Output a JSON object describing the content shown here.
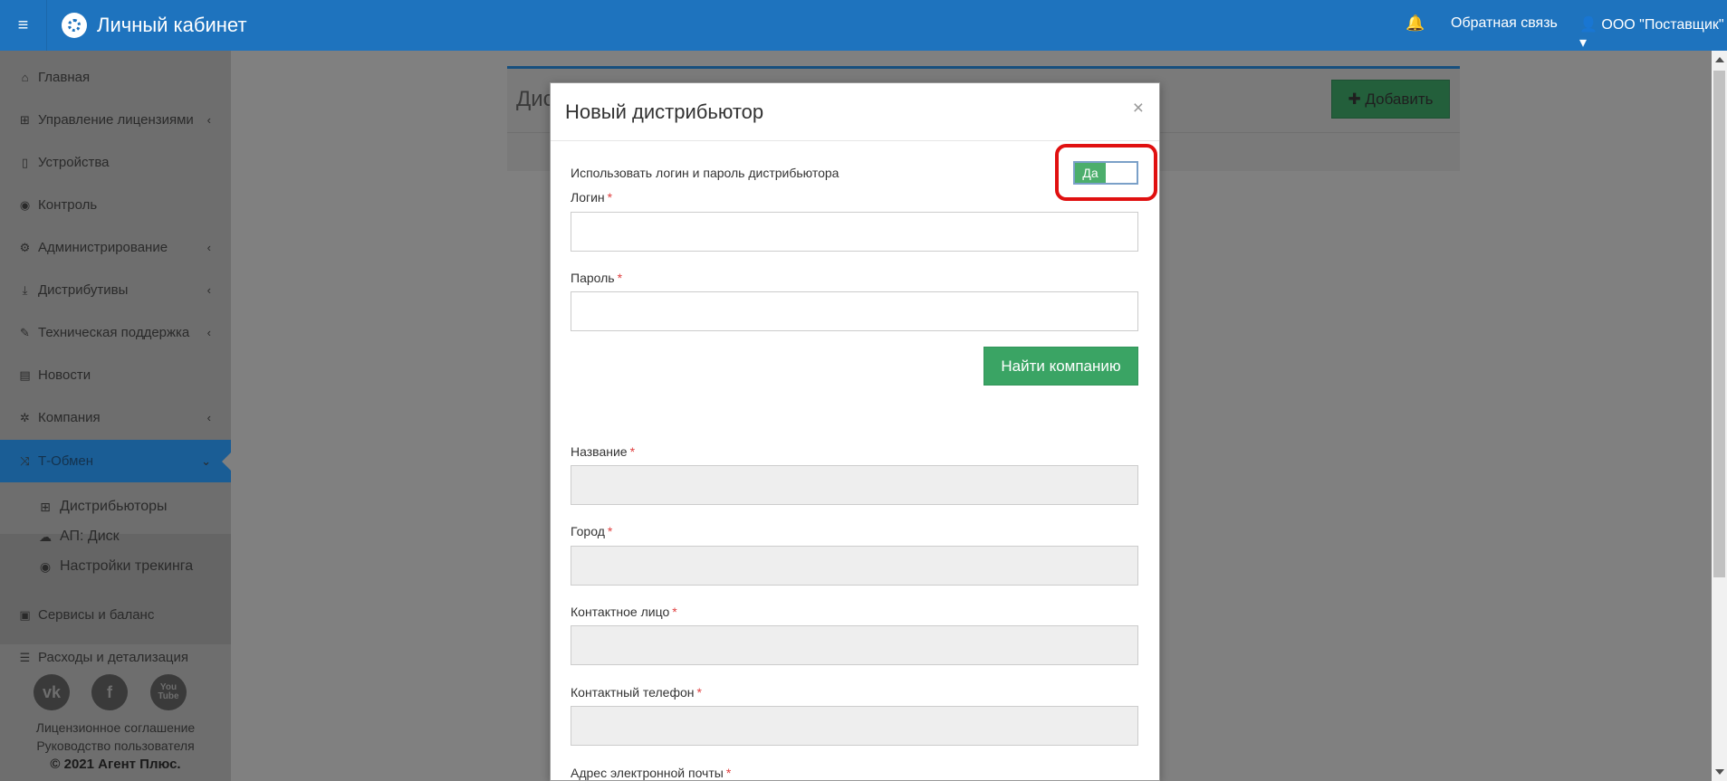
{
  "header": {
    "title": "Личный кабинет",
    "feedback": "Обратная связь",
    "user": "ООО \"Поставщик\" ▾",
    "menu_icon": "≡",
    "bell_icon": "🔔",
    "user_icon": "👤"
  },
  "sidebar": {
    "items": [
      {
        "label": "Главная",
        "icon": "⌂"
      },
      {
        "label": "Управление лицензиями",
        "icon": "⊞",
        "chevron": "‹"
      },
      {
        "label": "Устройства",
        "icon": "▯"
      },
      {
        "label": "Контроль",
        "icon": "◉"
      },
      {
        "label": "Администрирование",
        "icon": "⚙",
        "chevron": "‹"
      },
      {
        "label": "Дистрибутивы",
        "icon": "⤓",
        "chevron": "‹"
      },
      {
        "label": "Техническая поддержка",
        "icon": "✎",
        "chevron": "‹"
      },
      {
        "label": "Новости",
        "icon": "▤"
      },
      {
        "label": "Компания",
        "icon": "✲",
        "chevron": "‹"
      },
      {
        "label": "Т-Обмен",
        "icon": "⤨",
        "chevron": "⌄"
      },
      {
        "label": "Сервисы и баланс",
        "icon": "▣"
      },
      {
        "label": "Расходы и детализация",
        "icon": "☰"
      }
    ],
    "submenu": [
      {
        "label": "Дистрибьюторы",
        "icon": "⊞"
      },
      {
        "label": "АП: Диск",
        "icon": "☁"
      },
      {
        "label": "Настройки трекинга",
        "icon": "◉"
      }
    ],
    "social": [
      "vk",
      "f",
      "You Tube"
    ],
    "footer_links": [
      "Лицензионное соглашение",
      "Руководство пользователя"
    ],
    "copyright": "© 2021 Агент Плюс."
  },
  "background": {
    "panel_title": "Дис",
    "add_button": "✚ Добавить"
  },
  "modal": {
    "title": "Новый дистрибьютор",
    "close": "×",
    "toggle_label": "Использовать логин и пароль дистрибьютора",
    "toggle_value": "Да",
    "login_label": "Логин",
    "password_label": "Пароль",
    "find_button": "Найти компанию",
    "name_label": "Название",
    "city_label": "Город",
    "contact_label": "Контактное лицо",
    "phone_label": "Контактный телефон",
    "email_label": "Адрес электронной почты",
    "required_mark": "*"
  },
  "colors": {
    "brand": "#1e73be",
    "sidebar_active": "#1a5d95",
    "success": "#3aa464",
    "highlight": "#e01010"
  }
}
